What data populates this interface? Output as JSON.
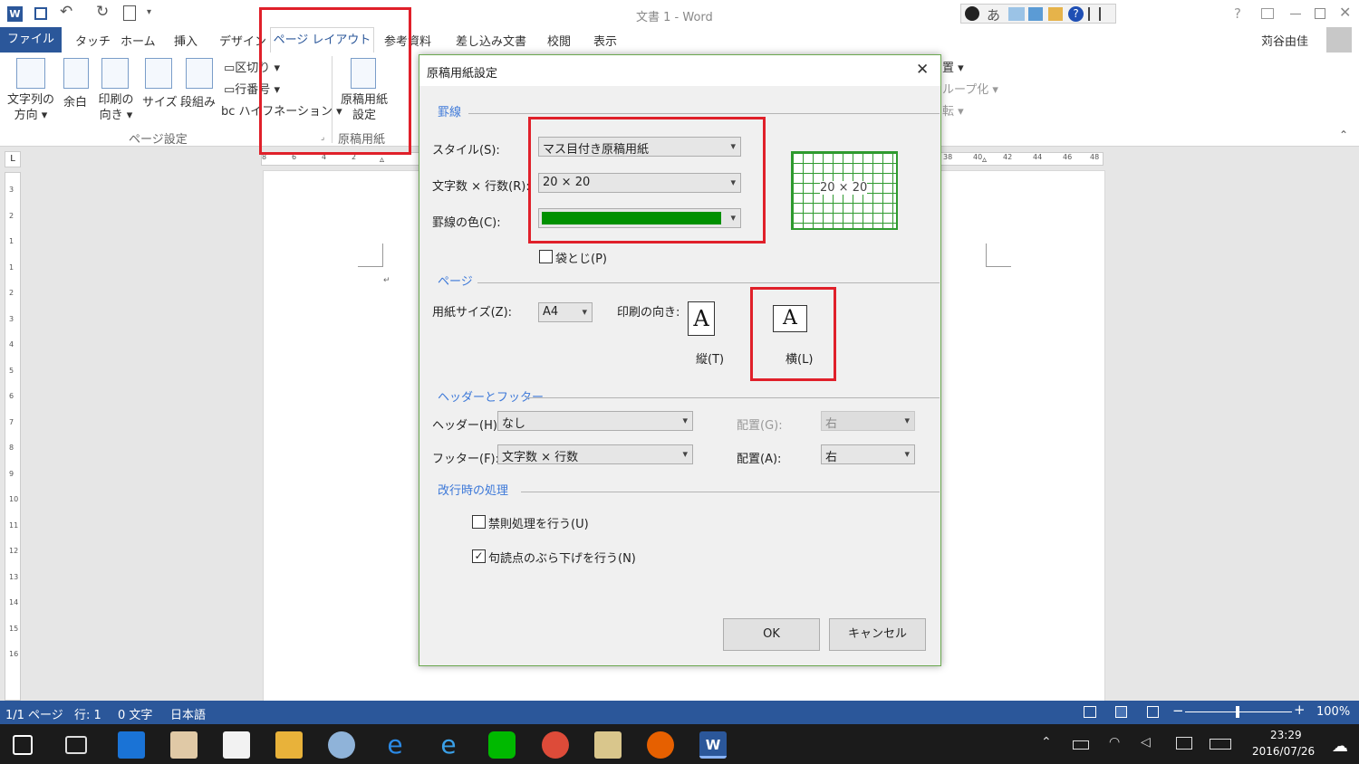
{
  "app": {
    "title": "文書 1 - Word",
    "user": "苅谷由佳",
    "tabs": [
      "ファイル",
      "タッチ",
      "ホーム",
      "挿入",
      "デザイン",
      "ページ レイアウト",
      "参考資料",
      "差し込み文書",
      "校閲",
      "表示"
    ],
    "active_tab": "ページ レイアウト",
    "accent": "#2b579a"
  },
  "ribbon": {
    "btn_text_direction": [
      "文字列の",
      "方向"
    ],
    "btn_margins": "余白",
    "btn_orientation": [
      "印刷の",
      "向き"
    ],
    "btn_size": "サイズ",
    "btn_columns": "段組み",
    "btn_breaks": "区切り",
    "btn_line_numbers": "行番号",
    "btn_hyphenation": "ハイフネーション",
    "btn_genkou": [
      "原稿用紙",
      "設定"
    ],
    "group_page_setup": "ページ設定",
    "group_genkou": "原稿用紙",
    "right_partial": [
      "置",
      "ループ化",
      "転"
    ]
  },
  "ruler_ticks": [
    "8",
    "6",
    "4",
    "2",
    "38",
    "40",
    "42",
    "44",
    "46",
    "48"
  ],
  "vruler_ticks": [
    "3",
    "2",
    "1",
    "1",
    "2",
    "3",
    "4",
    "5",
    "6",
    "7",
    "8",
    "9",
    "10",
    "11",
    "12",
    "13",
    "14",
    "15",
    "16"
  ],
  "dialog": {
    "title": "原稿用紙設定",
    "section_lines": "罫線",
    "style_label": "スタイル(S):",
    "style_value": "マス目付き原稿用紙",
    "chars_label": "文字数 × 行数(R):",
    "chars_value": "20 × 20",
    "color_label": "罫線の色(C):",
    "color_value": "#009000",
    "fold_label": "袋とじ(P)",
    "fold_checked": false,
    "preview_text": "20 × 20",
    "section_page": "ページ",
    "paper_label": "用紙サイズ(Z):",
    "paper_value": "A4",
    "orient_label": "印刷の向き:",
    "portrait_label": "縦(T)",
    "landscape_label": "横(L)",
    "section_hf": "ヘッダーとフッター",
    "header_label": "ヘッダー(H):",
    "header_value": "なし",
    "header_align_label": "配置(G):",
    "header_align_value": "右",
    "footer_label": "フッター(F):",
    "footer_value": "文字数 × 行数",
    "footer_align_label": "配置(A):",
    "footer_align_value": "右",
    "section_linebreak": "改行時の処理",
    "kinsoku_label": "禁則処理を行う(U)",
    "kinsoku_checked": false,
    "burasage_label": "句読点のぶら下げを行う(N)",
    "burasage_checked": true,
    "ok": "OK",
    "cancel": "キャンセル"
  },
  "status": {
    "page": "1/1 ページ",
    "line": "行: 1",
    "words": "0 文字",
    "lang": "日本語",
    "zoom": "100%"
  },
  "taskbar": {
    "time": "23:29",
    "date": "2016/07/26"
  }
}
